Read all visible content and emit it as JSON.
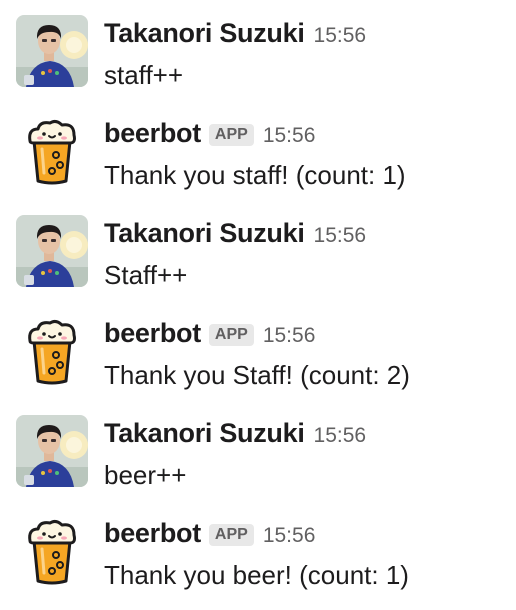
{
  "messages": [
    {
      "sender": "Takanori Suzuki",
      "avatar": "user-photo-avatar",
      "time": "15:56",
      "text": "staff++"
    },
    {
      "sender": "beerbot",
      "badge": "APP",
      "avatar": "beer-mug-icon",
      "time": "15:56",
      "text": "Thank you staff! (count: 1)"
    },
    {
      "sender": "Takanori Suzuki",
      "avatar": "user-photo-avatar",
      "time": "15:56",
      "text": "Staff++"
    },
    {
      "sender": "beerbot",
      "badge": "APP",
      "avatar": "beer-mug-icon",
      "time": "15:56",
      "text": "Thank you Staff! (count: 2)"
    },
    {
      "sender": "Takanori Suzuki",
      "avatar": "user-photo-avatar",
      "time": "15:56",
      "text": "beer++"
    },
    {
      "sender": "beerbot",
      "badge": "APP",
      "avatar": "beer-mug-icon",
      "time": "15:56",
      "text": "Thank you beer! (count: 1)"
    }
  ],
  "colors": {
    "text": "#1d1c1d",
    "muted": "#616061",
    "badge_bg": "#e8e8e8",
    "beer": "#f5a623",
    "foam": "#fdf6e3"
  }
}
